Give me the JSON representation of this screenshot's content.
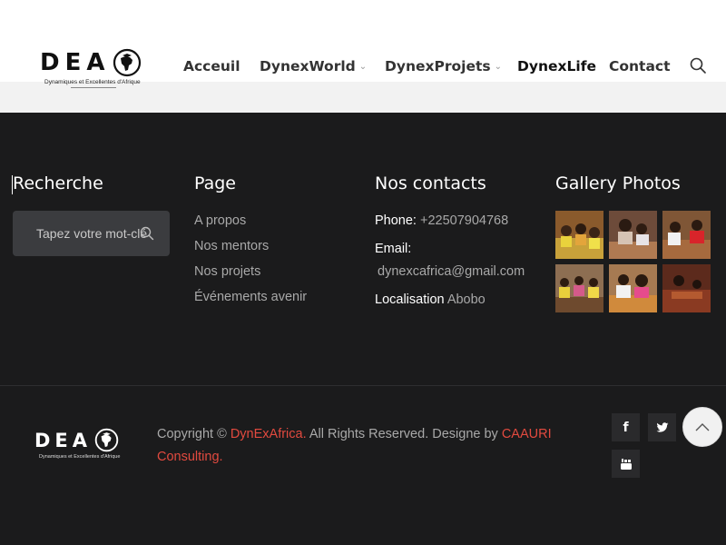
{
  "header": {
    "logo": {
      "letters": "DEA",
      "tagline": "Dynamiques et Excellentes d'Afrique"
    },
    "nav": [
      {
        "label": "Acceuil",
        "has_dropdown": false
      },
      {
        "label": "DynexWorld",
        "has_dropdown": true
      },
      {
        "label": "DynexProjets",
        "has_dropdown": true
      },
      {
        "label": "DynexLife",
        "has_dropdown": false
      },
      {
        "label": "Contact",
        "has_dropdown": false
      }
    ],
    "search_icon": "search-icon"
  },
  "footer": {
    "search": {
      "title": "Recherche",
      "placeholder": "Tapez votre mot-clé"
    },
    "page": {
      "title": "Page",
      "links": [
        "A propos",
        "Nos mentors",
        "Nos projets",
        "Événements avenir"
      ]
    },
    "contacts": {
      "title": "Nos contacts",
      "phone_label": "Phone:",
      "phone": "+22507904768",
      "email_label": "Email:",
      "email": "dynexcafrica@gmail.com",
      "location_label": "Localisation",
      "location": "Abobo"
    },
    "gallery": {
      "title": "Gallery Photos",
      "count": 6
    },
    "bottom": {
      "logo": {
        "letters": "DEA",
        "tagline": "Dynamiques et Excellentes d'Afrique"
      },
      "copyright_prefix": "Copyright ©",
      "brand": "DynExAfrica.",
      "rights": "All Rights Reserved. Designe by",
      "designer": "CAAURI Consulting.",
      "social": [
        "facebook-icon",
        "twitter-icon",
        "youtube-icon"
      ],
      "back_to_top_icon": "chevron-up-icon"
    }
  },
  "colors": {
    "footer_bg": "#1b1b1c",
    "accent_red": "#e24a3f",
    "muted_text": "#a9a9a9",
    "search_box": "#3b3c3f"
  }
}
